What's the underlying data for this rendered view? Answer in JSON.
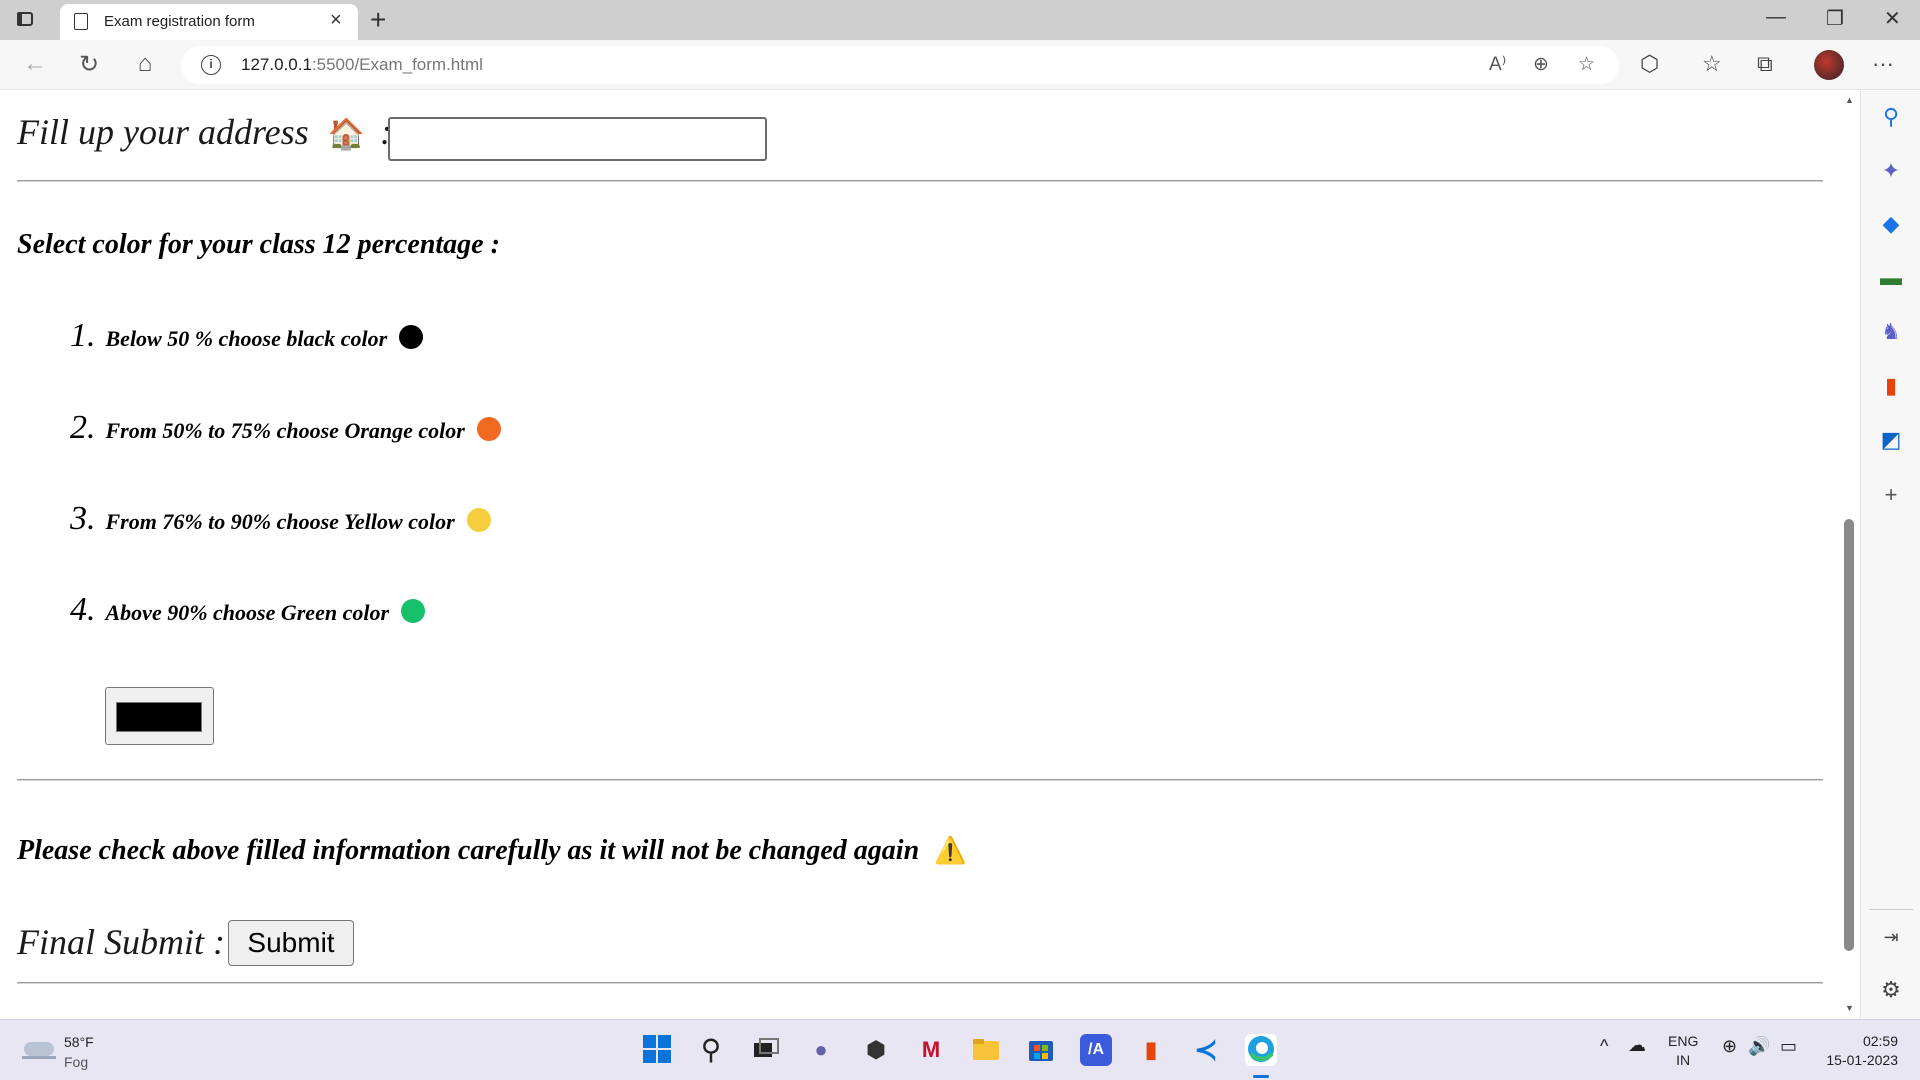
{
  "browser": {
    "tab_title": "Exam registration form",
    "url_host": "127.0.0.1",
    "url_rest": ":5500/Exam_form.html"
  },
  "form": {
    "address_label": "Fill up your address",
    "address_emoji": "🏠",
    "address_colon": ":",
    "address_value": "",
    "color_heading": "Select color for your class 12 percentage :",
    "options": [
      {
        "num": "1.",
        "text": "Below 50 % choose black color",
        "color": "#000000"
      },
      {
        "num": "2.",
        "text": "From 50% to 75% choose Orange color",
        "color": "#f26a21"
      },
      {
        "num": "3.",
        "text": "From 76% to 90% choose Yellow color",
        "color": "#f5cd3d"
      },
      {
        "num": "4.",
        "text": "Above 90% choose Green color",
        "color": "#15c16b"
      }
    ],
    "picker_color": "#000000",
    "warning_text": "Please check above filled information carefully as it will not be changed again",
    "warning_emoji": "⚠️",
    "final_label": "Final Submit :",
    "submit_label": "Submit"
  },
  "taskbar": {
    "temperature": "58°F",
    "weather": "Fog",
    "lang_top": "ENG",
    "lang_bottom": "IN",
    "time": "02:59",
    "date": "15-01-2023"
  }
}
